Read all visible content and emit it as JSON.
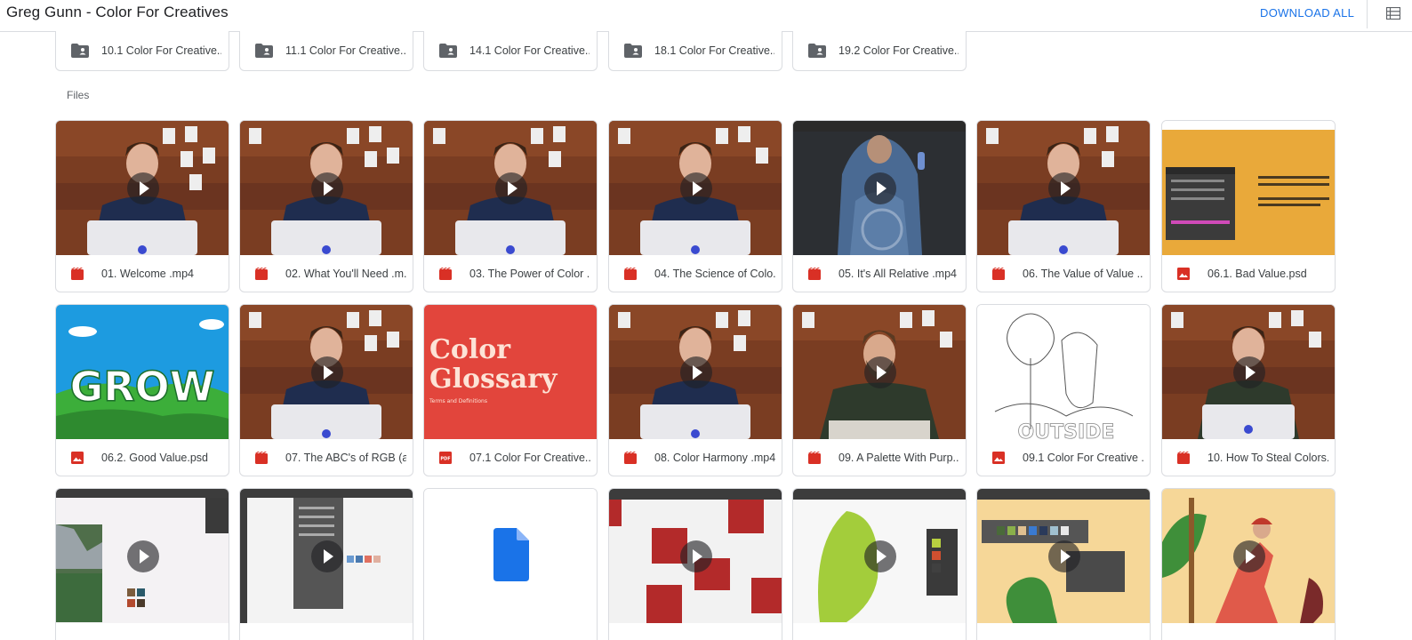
{
  "header": {
    "title": "Greg Gunn - Color For Creatives",
    "download_all": "DOWNLOAD ALL",
    "list_view_icon": "list-view-icon"
  },
  "folders": [
    {
      "label": "10.1 Color For Creative..."
    },
    {
      "label": "11.1 Color For Creative..."
    },
    {
      "label": "14.1 Color For Creative..."
    },
    {
      "label": "18.1 Color For Creative..."
    },
    {
      "label": "19.2 Color For Creative..."
    }
  ],
  "files_label": "Files",
  "files": [
    {
      "name": "01. Welcome .mp4",
      "type": "video",
      "icon": "video-icon"
    },
    {
      "name": "02. What You'll Need .m...",
      "type": "video",
      "icon": "video-icon"
    },
    {
      "name": "03. The Power of Color ....",
      "type": "video",
      "icon": "video-icon"
    },
    {
      "name": "04. The Science of Colo...",
      "type": "video",
      "icon": "video-icon"
    },
    {
      "name": "05. It's All Relative .mp4",
      "type": "video",
      "icon": "video-icon"
    },
    {
      "name": "06. The Value of Value ....",
      "type": "video",
      "icon": "video-icon"
    },
    {
      "name": "06.1. Bad Value.psd",
      "type": "image",
      "icon": "image-icon"
    },
    {
      "name": "06.2. Good Value.psd",
      "type": "image",
      "icon": "image-icon"
    },
    {
      "name": "07. The ABC's of RGB (a...",
      "type": "video",
      "icon": "video-icon"
    },
    {
      "name": "07.1 Color For Creative...",
      "type": "pdf",
      "icon": "pdf-icon"
    },
    {
      "name": "08. Color Harmony .mp4",
      "type": "video",
      "icon": "video-icon"
    },
    {
      "name": "09. A Palette With Purp...",
      "type": "video",
      "icon": "video-icon"
    },
    {
      "name": "09.1 Color For Creative ...",
      "type": "image",
      "icon": "image-icon"
    },
    {
      "name": "10. How To Steal Colors...",
      "type": "video",
      "icon": "video-icon"
    }
  ],
  "thumb_text": {
    "grow": "GROW",
    "glossary_line1": "Color",
    "glossary_line2": "Glossary",
    "glossary_sub": "Terms and Definitions"
  },
  "colors": {
    "accent": "#1a73e8",
    "video_red": "#d93025",
    "glossary_red": "#e2453c",
    "border": "#dadce0"
  }
}
